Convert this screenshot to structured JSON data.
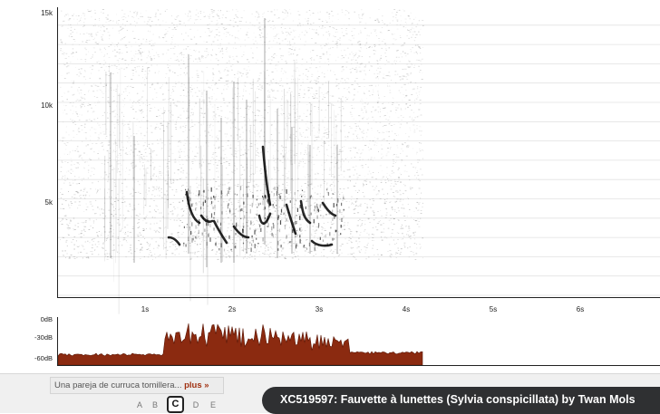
{
  "spectrogram": {
    "freq_axis": {
      "ticks": [
        "15k",
        "10k",
        "5k"
      ]
    },
    "time_axis": {
      "ticks": [
        "1s",
        "2s",
        "3s",
        "4s",
        "5s",
        "6s"
      ]
    },
    "ink_color": "#000000"
  },
  "amplitude": {
    "db_ticks": [
      "0dB",
      "-30dB",
      "-60dB"
    ],
    "fill_color": "#8b2a10"
  },
  "recording": {
    "description": "Una pareja de curruca tomillera...",
    "more_label": "plus »",
    "title": "XC519597: Fauvette à lunettes (Sylvia conspicillata) by Twan Mols"
  },
  "quality_ratings": {
    "options": [
      "A",
      "B",
      "C",
      "D",
      "E"
    ],
    "selected": "C"
  }
}
